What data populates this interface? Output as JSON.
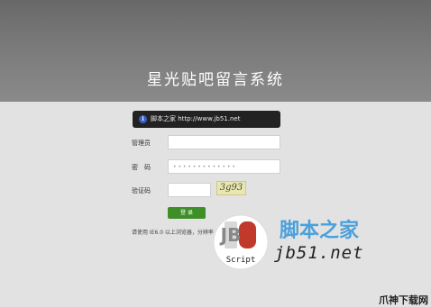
{
  "page": {
    "title": "星光贴吧留言系统"
  },
  "notice": {
    "icon": "info-icon",
    "icon_glyph": "i",
    "text": "脚本之家 http://www.jb51.net"
  },
  "form": {
    "username_label": "管理员",
    "password_label": "密　码",
    "captcha_label": "验证码",
    "username_value": "",
    "password_value": "• • • • • • • • • • • • •",
    "captcha_value": "",
    "captcha_image_text": "3g93",
    "login_label": "登 录"
  },
  "footer": {
    "text": "请使用 IE6.0 以上浏览器，分辨率 1024×768"
  },
  "watermark": {
    "logo_letters": "JB",
    "logo_caption": "Script",
    "brand": "脚本之家",
    "url": "jb51.net",
    "corner": "爪神下载网"
  },
  "colors": {
    "header_bg": "#777777",
    "page_bg": "#e2e2e2",
    "login_button": "#3e8f27",
    "notice_bg": "#222222"
  }
}
